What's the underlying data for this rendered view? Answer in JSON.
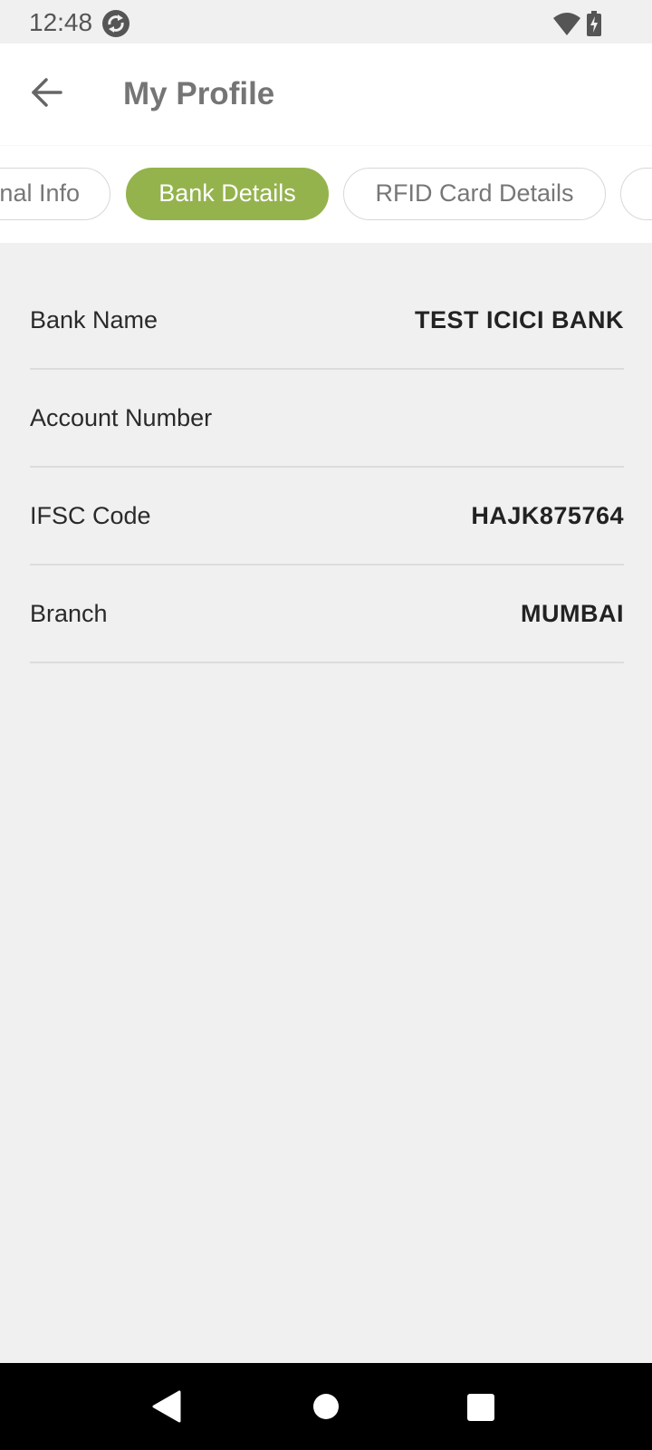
{
  "status_bar": {
    "time": "12:48",
    "icons": [
      "sync-icon",
      "wifi-icon",
      "battery-charging-icon"
    ]
  },
  "app_bar": {
    "title": "My Profile",
    "back_icon": "arrow-left-icon"
  },
  "tabs": [
    {
      "label": "Personal Info",
      "visible_text": "nal Info",
      "selected": false
    },
    {
      "label": "Bank Details",
      "visible_text": "Bank Details",
      "selected": true
    },
    {
      "label": "RFID Card Details",
      "visible_text": "RFID Card Details",
      "selected": false
    },
    {
      "label": "",
      "visible_text": "",
      "selected": false
    }
  ],
  "bank_details": [
    {
      "label": "Bank Name",
      "value": "TEST ICICI BANK"
    },
    {
      "label": "Account Number",
      "value": ""
    },
    {
      "label": "IFSC Code",
      "value": "HAJK875764"
    },
    {
      "label": "Branch",
      "value": "MUMBAI"
    }
  ],
  "nav_bar": {
    "icons": [
      "nav-back-icon",
      "nav-home-icon",
      "nav-recents-icon"
    ]
  },
  "colors": {
    "accent": "#94b34d",
    "background": "#f0f0f0",
    "surface": "#ffffff",
    "title_text": "#757575",
    "divider": "#dcdcdc"
  }
}
